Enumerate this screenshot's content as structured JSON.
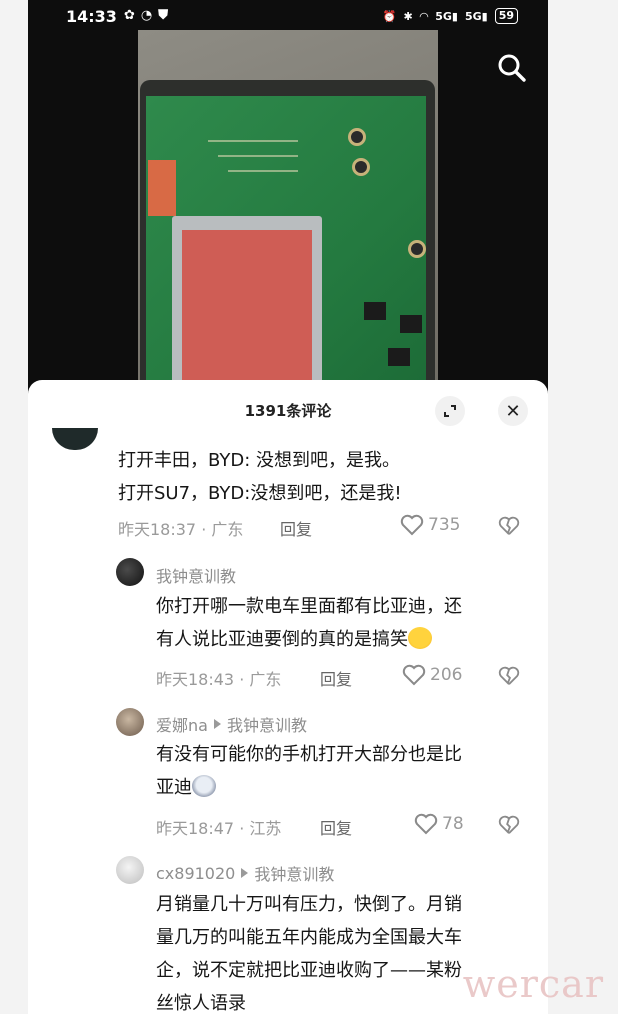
{
  "status_bar": {
    "time": "14:33",
    "left_icons": [
      "wechat-icon",
      "qq-icon",
      "shield-check-icon"
    ],
    "right_icons": [
      "alarm-icon",
      "bluetooth-icon",
      "wifi-icon",
      "signal-5g-icon",
      "signal-5g-icon"
    ],
    "battery": "59"
  },
  "video": {
    "search_icon": "search-icon"
  },
  "comments_sheet": {
    "title": "1391条评论",
    "expand_icon": "expand-icon",
    "close_label": "✕",
    "top_comment": {
      "line1": "打开丰田，BYD: 没想到吧，是我。",
      "line2": "打开SU7，BYD:没想到吧，还是我!",
      "time": "昨天18:37",
      "location": "广东",
      "reply_label": "回复",
      "likes": "735"
    },
    "replies": [
      {
        "username": "我钟意训教",
        "reply_to": "",
        "line1": "你打开哪一款电车里面都有比亚迪，还",
        "line2": "有人说比亚迪要倒的真的是搞笑",
        "emoji": "laugh-cry-emoji",
        "time": "昨天18:43",
        "location": "广东",
        "reply_label": "回复",
        "likes": "206"
      },
      {
        "username": "爱娜na",
        "reply_to": "我钟意训教",
        "line1": "有没有可能你的手机打开大部分也是比",
        "line2": "亚迪",
        "emoji": "cat-emoji",
        "time": "昨天18:47",
        "location": "江苏",
        "reply_label": "回复",
        "likes": "78"
      },
      {
        "username": "cx891020",
        "reply_to": "我钟意训教",
        "line1": "月销量几十万叫有压力，快倒了。月销",
        "line2": "量几万的叫能五年内能成为全国最大车",
        "line3": "企，说不定就把比亚迪收购了——某粉",
        "line4": "丝惊人语录"
      }
    ]
  },
  "watermark": "wercar",
  "colors": {
    "accent_text": "#161616",
    "meta_text": "#9a9a9a",
    "sheet_bg": "#ffffff"
  }
}
